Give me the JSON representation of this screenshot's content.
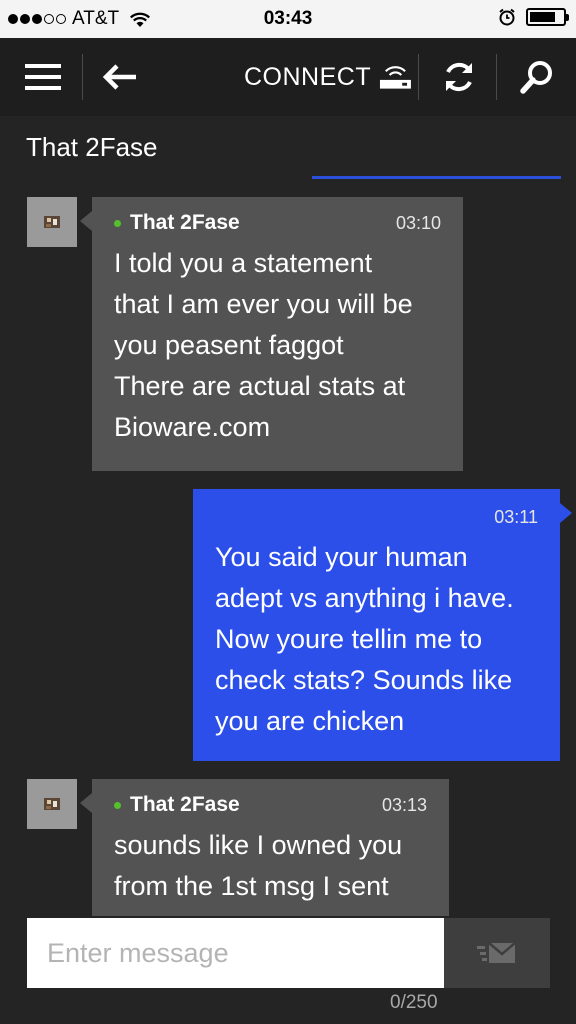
{
  "status_bar": {
    "carrier": "AT&T",
    "time": "03:43",
    "battery_level": 0.8
  },
  "toolbar": {
    "connect_label": "CONNECT"
  },
  "conversation": {
    "title": "That 2Fase"
  },
  "messages": [
    {
      "direction": "in",
      "sender": "That 2Fase",
      "time": "03:10",
      "text": "I told you a statement\nthat I am ever you will be\nyou peasent faggot\nThere are actual stats at\nBioware.com"
    },
    {
      "direction": "out",
      "time": "03:11",
      "text": "You said your human\nadept vs anything i have.\nNow youre tellin me to\ncheck stats? Sounds like\nyou are chicken"
    },
    {
      "direction": "in",
      "sender": "That 2Fase",
      "time": "03:13",
      "text": "sounds like I owned you\nfrom the 1st msg I sent"
    }
  ],
  "composer": {
    "placeholder": "Enter message",
    "counter": "0/250"
  },
  "colors": {
    "accent": "#2b4fe8",
    "incoming_bubble": "#535353",
    "background": "#242424",
    "online": "#56c02b"
  }
}
